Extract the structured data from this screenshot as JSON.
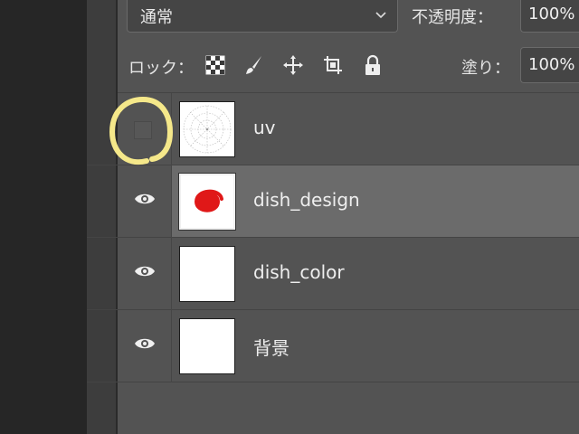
{
  "toolbar": {
    "blend_mode": "通常",
    "opacity_label": "不透明度：",
    "opacity_value": "100%",
    "lock_label": "ロック：",
    "fill_label": "塗り：",
    "fill_value": "100%"
  },
  "icons": {
    "lock_transparent": "checkerboard-icon",
    "lock_pixels": "brush-icon",
    "lock_position": "move-icon",
    "lock_artboard": "crop-artboard-icon",
    "lock_all": "padlock-icon",
    "visibility": "eye-icon"
  },
  "layers": [
    {
      "name": "uv",
      "visible": false,
      "selected": false,
      "thumbnail": "uv-grid"
    },
    {
      "name": "dish_design",
      "visible": true,
      "selected": true,
      "thumbnail": "red-spiral"
    },
    {
      "name": "dish_color",
      "visible": true,
      "selected": false,
      "thumbnail": "white"
    },
    {
      "name": "背景",
      "visible": true,
      "selected": false,
      "thumbnail": "white"
    }
  ],
  "colors": {
    "panel_bg": "#535353",
    "selected_bg": "#6b6b6b",
    "highlight": "#f5e88a",
    "spiral": "#e01818"
  }
}
